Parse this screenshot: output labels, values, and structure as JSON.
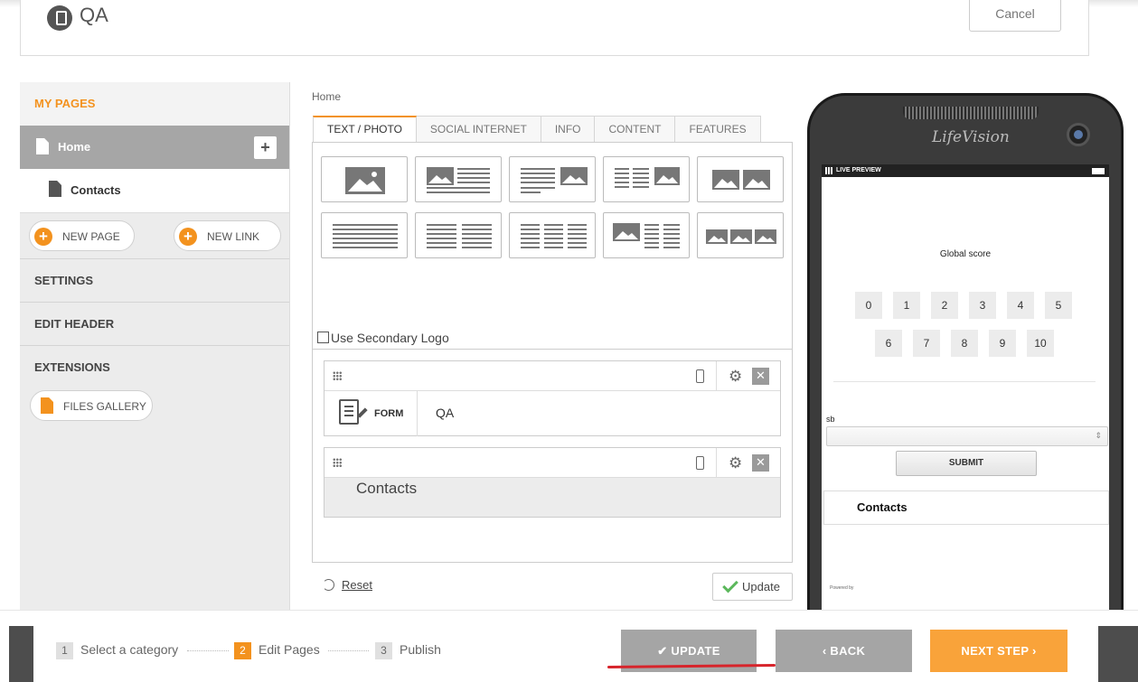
{
  "header": {
    "title": "QA",
    "cancel_label": "Cancel"
  },
  "sidebar": {
    "my_pages": "MY PAGES",
    "pages": [
      {
        "label": "Home"
      },
      {
        "label": "Contacts"
      }
    ],
    "new_page": "NEW PAGE",
    "new_link": "NEW LINK",
    "sections": [
      "SETTINGS",
      "EDIT HEADER",
      "EXTENSIONS"
    ],
    "files_gallery": "FILES GALLERY"
  },
  "editor": {
    "breadcrumb": "Home",
    "tabs": [
      "TEXT / PHOTO",
      "SOCIAL INTERNET",
      "INFO",
      "CONTENT",
      "FEATURES"
    ],
    "active_tab": "TEXT / PHOTO",
    "secondary_logo": "Use Secondary Logo",
    "blocks": [
      {
        "type_label": "FORM",
        "value": "QA"
      },
      {
        "value": "Contacts"
      }
    ],
    "reset": "Reset",
    "update": "Update"
  },
  "phone": {
    "brand": "LifeVision",
    "status": "LIVE PREVIEW",
    "global_score": "Global score",
    "scores_row1": [
      "0",
      "1",
      "2",
      "3",
      "4",
      "5"
    ],
    "scores_row2": [
      "6",
      "7",
      "8",
      "9",
      "10"
    ],
    "sb_label": "sb",
    "submit": "SUBMIT",
    "contacts": "Contacts",
    "powered": "Powered by"
  },
  "footer": {
    "steps": [
      {
        "num": "1",
        "label": "Select a category"
      },
      {
        "num": "2",
        "label": "Edit Pages"
      },
      {
        "num": "3",
        "label": "Publish"
      }
    ],
    "update": "UPDATE",
    "back": "BACK",
    "next": "NEXT STEP"
  },
  "colors": {
    "accent": "#f3921e",
    "success": "#5cb85c",
    "underline": "#d7242b"
  }
}
